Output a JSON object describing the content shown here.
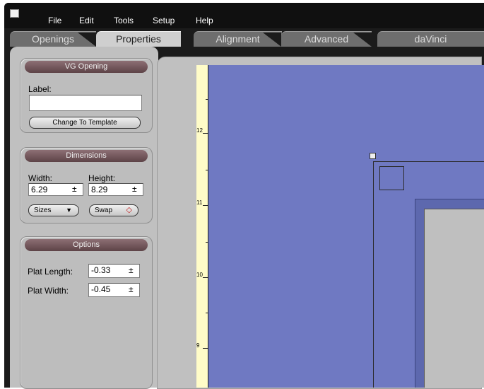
{
  "menu": {
    "file": "File",
    "edit": "Edit",
    "tools": "Tools",
    "setup": "Setup",
    "help": "Help"
  },
  "tabs": [
    "Openings",
    "Properties",
    "Alignment",
    "Advanced",
    "daVinci"
  ],
  "active_tab": "Properties",
  "vg_opening": {
    "title": "VG Opening",
    "label_caption": "Label:",
    "label_value": "",
    "change_template_button": "Change To Template"
  },
  "dimensions": {
    "title": "Dimensions",
    "width_caption": "Width:",
    "height_caption": "Height:",
    "width_value": "6.29",
    "height_value": "8.29",
    "sizes_button": "Sizes",
    "swap_button": "Swap"
  },
  "options": {
    "title": "Options",
    "plat_length_caption": "Plat Length:",
    "plat_length_value": "-0.33",
    "plat_width_caption": "Plat Width:",
    "plat_width_value": "-0.45"
  },
  "ruler": {
    "labels": [
      "12",
      "11",
      "10",
      "9"
    ]
  },
  "colors": {
    "canvas": "#6f79c2",
    "ruler": "#fffcc8",
    "header": "#6b5055",
    "panel": "#c0c0c0"
  }
}
